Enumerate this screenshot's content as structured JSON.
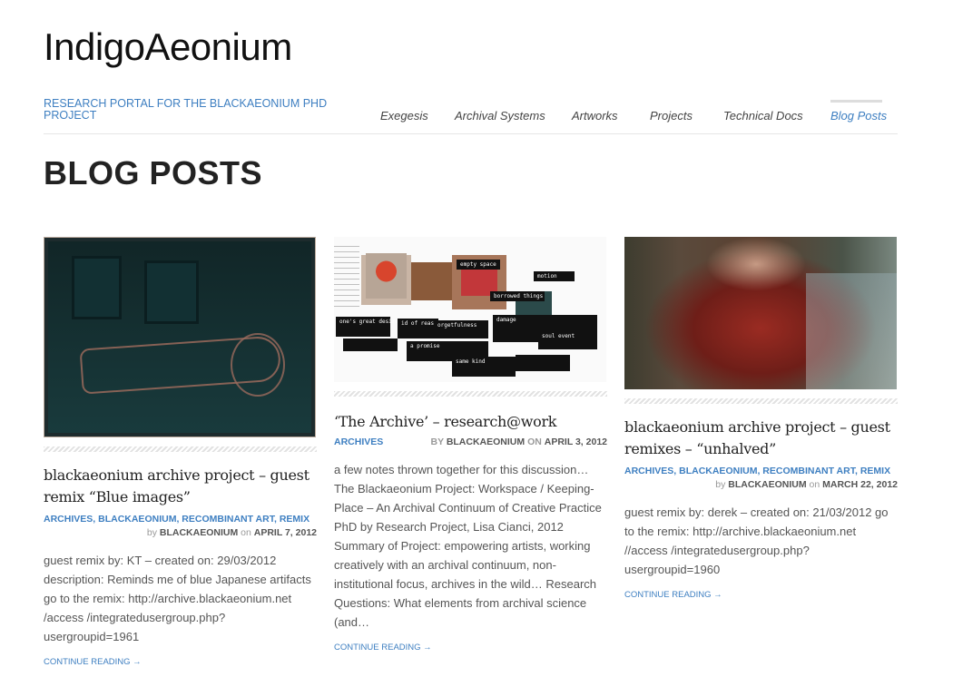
{
  "site": {
    "title": "IndigoAeonium",
    "tagline": "RESEARCH PORTAL FOR THE BLACKAEONIUM PHD PROJECT"
  },
  "nav": {
    "items": [
      {
        "label": "Exegesis"
      },
      {
        "label": "Archival Systems"
      },
      {
        "label": "Artworks"
      },
      {
        "label": "Projects"
      },
      {
        "label": "Technical Docs"
      },
      {
        "label": "Blog Posts",
        "active": true
      }
    ]
  },
  "page": {
    "title": "BLOG POSTS"
  },
  "posts": [
    {
      "title": "blackaeonium archive project – guest remix “Blue images”",
      "categories": [
        "ARCHIVES",
        "BLACKAEONIUM",
        "RECOMBINANT ART",
        "REMIX"
      ],
      "by": "by",
      "author": "BLACKAEONIUM",
      "on": "on",
      "date": "APRIL 7, 2012",
      "excerpt": "guest remix by: KT – created on: 29/03/2012 description: Reminds me of blue Japanese artifacts go to the remix: http://archive.blackaeonium.net /access /integratedusergroup.php?usergroupid=1961",
      "more": "CONTINUE READING →"
    },
    {
      "title": "‘The Archive’ – research@work",
      "categories": [
        "ARCHIVES"
      ],
      "by": "by",
      "author": "BLACKAEONIUM",
      "on": "on",
      "date": "APRIL 3, 2012",
      "excerpt": "a few notes thrown together for this discussion… The Blackaeonium Project: Workspace / Keeping-Place – An Archival Continuum of Creative Practice PhD by Research Project, Lisa Cianci, 2012   Summary of Project: empowering artists, working creatively with an archival continuum, non-institutional focus, archives in the wild… Research Questions: What elements from archival science (and…",
      "more": "CONTINUE READING →",
      "collage_words": [
        "empty space",
        "motion",
        "borrowed things",
        "one's great desire",
        "id of reason",
        "orgetfulness",
        "damage",
        "soul event",
        "a promise",
        "same kind"
      ]
    },
    {
      "title": "blackaeonium archive project – guest remixes – “unhalved”",
      "categories": [
        "ARCHIVES",
        "BLACKAEONIUM",
        "RECOMBINANT ART",
        "REMIX"
      ],
      "by": "by",
      "author": "BLACKAEONIUM",
      "on": "on",
      "date": "MARCH 22, 2012",
      "excerpt": "guest remix by: derek – created on: 21/03/2012 go to the remix: http://archive.blackaeonium.net //access /integratedusergroup.php?usergroupid=1960",
      "more": "CONTINUE READING →"
    }
  ],
  "colors": {
    "link": "#3e7fc1",
    "title": "#222222"
  }
}
